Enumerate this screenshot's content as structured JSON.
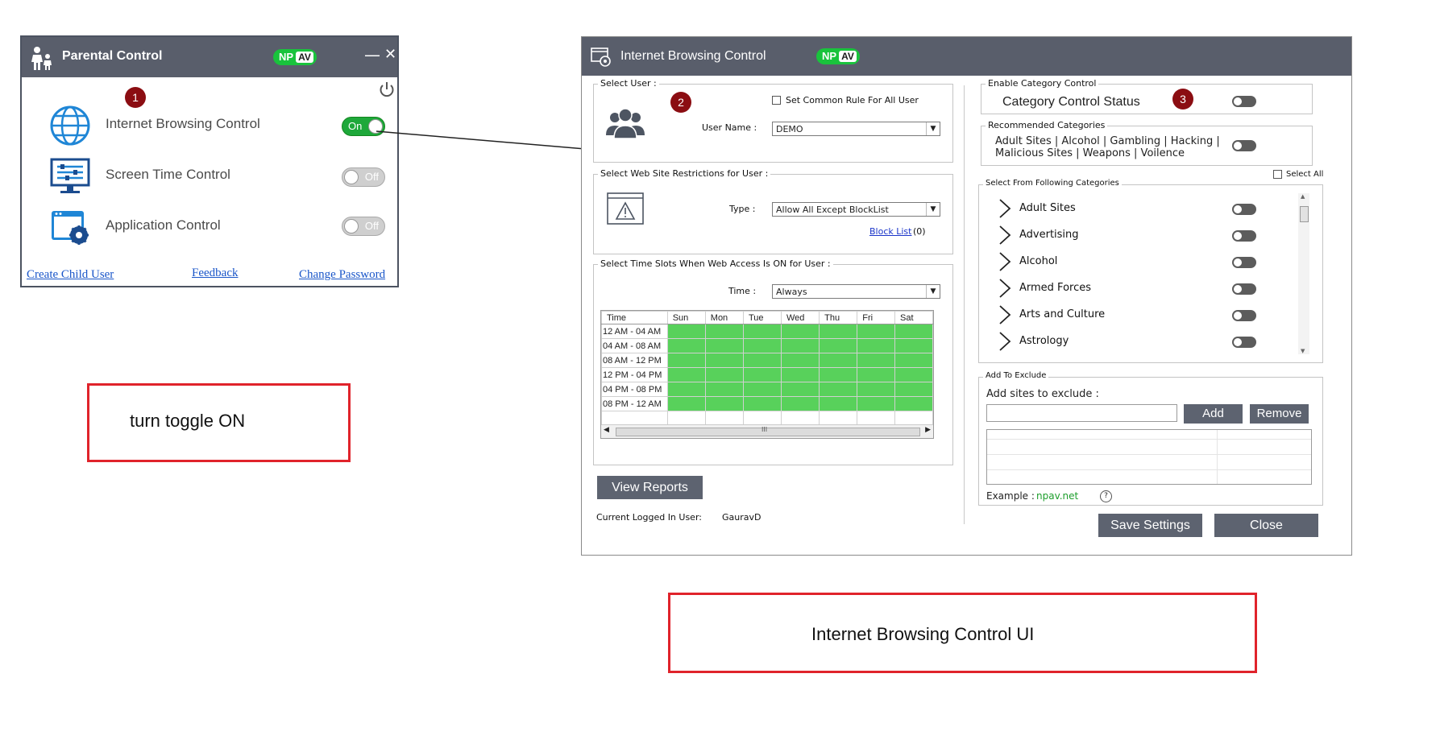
{
  "parental_control": {
    "title": "Parental Control",
    "badge_np": "NP",
    "badge_av": "AV",
    "minimize": "—",
    "close": "✕",
    "rows": [
      {
        "label": "Internet Browsing Control",
        "toggle": "On",
        "state": "on"
      },
      {
        "label": "Screen Time Control",
        "toggle": "Off",
        "state": "off"
      },
      {
        "label": "Application Control",
        "toggle": "Off",
        "state": "off"
      }
    ],
    "links": {
      "create_child_user": "Create Child User",
      "feedback": "Feedback",
      "change_password": "Change Password"
    }
  },
  "markers": {
    "one": "1",
    "two": "2",
    "three": "3"
  },
  "annotations": {
    "turn_toggle": "turn toggle ON",
    "ibc_ui": "Internet Browsing Control UI"
  },
  "internet_browsing_control": {
    "title": "Internet Browsing Control",
    "select_user": {
      "legend": "Select User :",
      "common_rule": "Set Common Rule For All User",
      "username_label": "User Name :",
      "username_value": "DEMO"
    },
    "restrictions": {
      "legend": "Select Web Site Restrictions for User :",
      "type_label": "Type :",
      "type_value": "Allow All Except BlockList",
      "block_list": "Block List",
      "block_count": "(0)"
    },
    "time_slots": {
      "legend": "Select Time Slots When Web Access Is ON for User :",
      "time_label": "Time :",
      "time_value": "Always",
      "headers": [
        "Time",
        "Sun",
        "Mon",
        "Tue",
        "Wed",
        "Thu",
        "Fri",
        "Sat"
      ],
      "rows": [
        "12 AM - 04 AM",
        "04 AM - 08 AM",
        "08 AM - 12 PM",
        "12 PM - 04 PM",
        "04 PM - 08 PM",
        "08 PM - 12 AM"
      ],
      "scroll_thumb": "III"
    },
    "view_reports": "View Reports",
    "current_user_label": "Current Logged In User:",
    "current_user_value": "GauravD",
    "category_control": {
      "legend": "Enable Category Control",
      "status_label": "Category Control Status"
    },
    "recommended": {
      "legend": "Recommended Categories",
      "line1": "Adult Sites | Alcohol | Gambling | Hacking |",
      "line2": "Malicious Sites | Weapons | Voilence"
    },
    "select_all": "Select All",
    "following": {
      "legend": "Select  From Following Categories",
      "items": [
        "Adult Sites",
        "Advertising",
        "Alcohol",
        "Armed Forces",
        "Arts and Culture",
        "Astrology"
      ]
    },
    "exclude": {
      "legend": "Add To Exclude",
      "label": "Add sites to exclude :",
      "add": "Add",
      "remove": "Remove",
      "example_label": "Example :",
      "example_value": "npav.net",
      "help": "?"
    },
    "save_settings": "Save Settings",
    "close": "Close"
  }
}
